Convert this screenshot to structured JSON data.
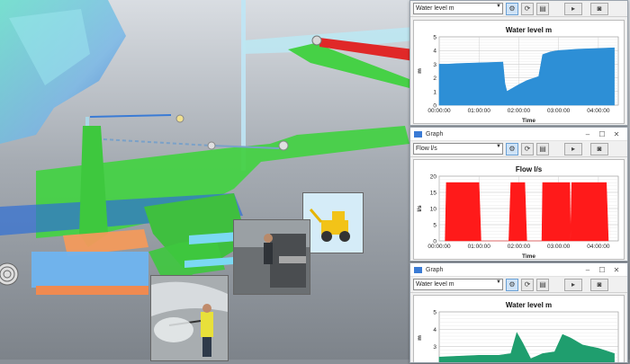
{
  "scene": {
    "description_icons": [
      "pipe-network-3d",
      "photo-worker-wall",
      "photo-worker-rig",
      "photo-loader-machine"
    ]
  },
  "windows": [
    {
      "title": "",
      "selected_series": "Water level m",
      "toolbar_icons": [
        "settings-icon",
        "refresh-icon",
        "table-icon",
        "export-icon",
        "camera-icon"
      ],
      "chart_data": {
        "type": "area",
        "title": "Water level m",
        "xlabel": "Time",
        "ylabel": "m",
        "ylim": [
          0,
          5
        ],
        "yticks": [
          "0",
          "1",
          "2",
          "3",
          "4",
          "5"
        ],
        "xticks": [
          "00:00:00",
          "01:00:00",
          "02:00:00",
          "03:00:00",
          "04:00:00"
        ],
        "x_hours": [
          0,
          0.2,
          0.5,
          1.0,
          1.6,
          1.65,
          1.7,
          2.0,
          2.2,
          2.5,
          2.6,
          2.8,
          3.0,
          3.5,
          4.0,
          4.4
        ],
        "values": [
          3.0,
          3.0,
          3.05,
          3.1,
          3.15,
          1.6,
          1.0,
          1.5,
          1.8,
          2.1,
          3.7,
          3.9,
          4.0,
          4.1,
          4.15,
          4.2
        ],
        "fill": "#2d8fd6"
      }
    },
    {
      "title": "Graph",
      "selected_series": "Flow l/s",
      "toolbar_icons": [
        "settings-icon",
        "refresh-icon",
        "table-icon",
        "export-icon",
        "camera-icon"
      ],
      "chart_data": {
        "type": "area",
        "title": "Flow l/s",
        "xlabel": "Time",
        "ylabel": "l/s",
        "ylim": [
          0,
          20
        ],
        "yticks": [
          "0",
          "5",
          "10",
          "15",
          "20"
        ],
        "xticks": [
          "00:00:00",
          "01:00:00",
          "02:00:00",
          "03:00:00",
          "04:00:00"
        ],
        "x_hours": [
          0.15,
          0.18,
          1.0,
          1.05,
          1.08,
          1.75,
          1.8,
          1.82,
          2.15,
          2.2,
          2.22,
          2.58,
          2.6,
          2.63,
          3.28,
          3.3,
          3.33,
          4.2,
          4.25
        ],
        "values": [
          0,
          18,
          18,
          0,
          0,
          0,
          18,
          18,
          18,
          0,
          0,
          0,
          18,
          18,
          18,
          0,
          18,
          18,
          0
        ],
        "fill": "#ff1a1a"
      }
    },
    {
      "title": "Graph",
      "selected_series": "Water level m",
      "toolbar_icons": [
        "settings-icon",
        "refresh-icon",
        "table-icon",
        "export-icon",
        "camera-icon"
      ],
      "chart_data": {
        "type": "area",
        "title": "Water level m",
        "xlabel": "",
        "ylabel": "m",
        "ylim": [
          2,
          5
        ],
        "yticks": [
          "2",
          "3",
          "4",
          "5"
        ],
        "xticks": [],
        "x_hours": [
          0,
          0.5,
          1.0,
          1.5,
          1.8,
          1.95,
          2.1,
          2.3,
          2.6,
          2.9,
          3.1,
          3.3,
          3.6,
          4.0,
          4.4
        ],
        "values": [
          2.4,
          2.45,
          2.5,
          2.5,
          2.6,
          3.8,
          3.2,
          2.3,
          2.6,
          2.7,
          3.7,
          3.5,
          3.1,
          2.9,
          2.6
        ],
        "fill": "#1f9e6e"
      }
    }
  ]
}
